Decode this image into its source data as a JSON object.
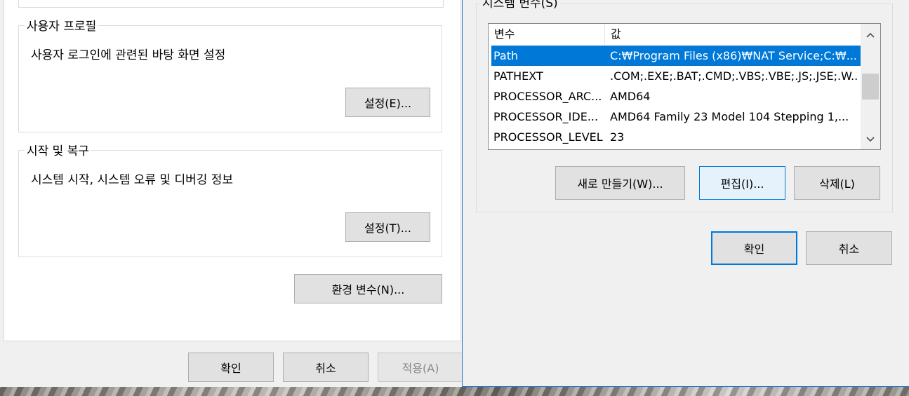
{
  "left_window": {
    "user_profiles": {
      "legend": "사용자 프로필",
      "description": "사용자 로그인에 관련된 바탕 화면 설정",
      "settings_button": "설정(E)..."
    },
    "startup_recovery": {
      "legend": "시작 및 복구",
      "description": "시스템 시작, 시스템 오류 및 디버깅 정보",
      "settings_button": "설정(T)..."
    },
    "env_vars_button": "환경 변수(N)...",
    "footer": {
      "ok": "확인",
      "cancel": "취소",
      "apply": "적용(A)"
    }
  },
  "right_window": {
    "system_vars_legend": "시스템 변수(S)",
    "columns": {
      "name": "변수",
      "value": "값"
    },
    "rows": [
      {
        "name": "Path",
        "value": "C:₩Program Files (x86)₩NAT Service;C:₩...",
        "selected": true
      },
      {
        "name": "PATHEXT",
        "value": ".COM;.EXE;.BAT;.CMD;.VBS;.VBE;.JS;.JSE;.W..."
      },
      {
        "name": "PROCESSOR_ARC...",
        "value": "AMD64"
      },
      {
        "name": "PROCESSOR_IDE...",
        "value": "AMD64 Family 23 Model 104 Stepping 1,..."
      },
      {
        "name": "PROCESSOR_LEVEL",
        "value": "23"
      }
    ],
    "buttons": {
      "new": "새로 만들기(W)...",
      "edit": "편집(I)...",
      "delete": "삭제(L)"
    },
    "footer": {
      "ok": "확인",
      "cancel": "취소"
    }
  },
  "colors": {
    "selection": "#0078d7",
    "focus_border": "#0078d7",
    "dialog_bg": "#f0f0f0"
  }
}
